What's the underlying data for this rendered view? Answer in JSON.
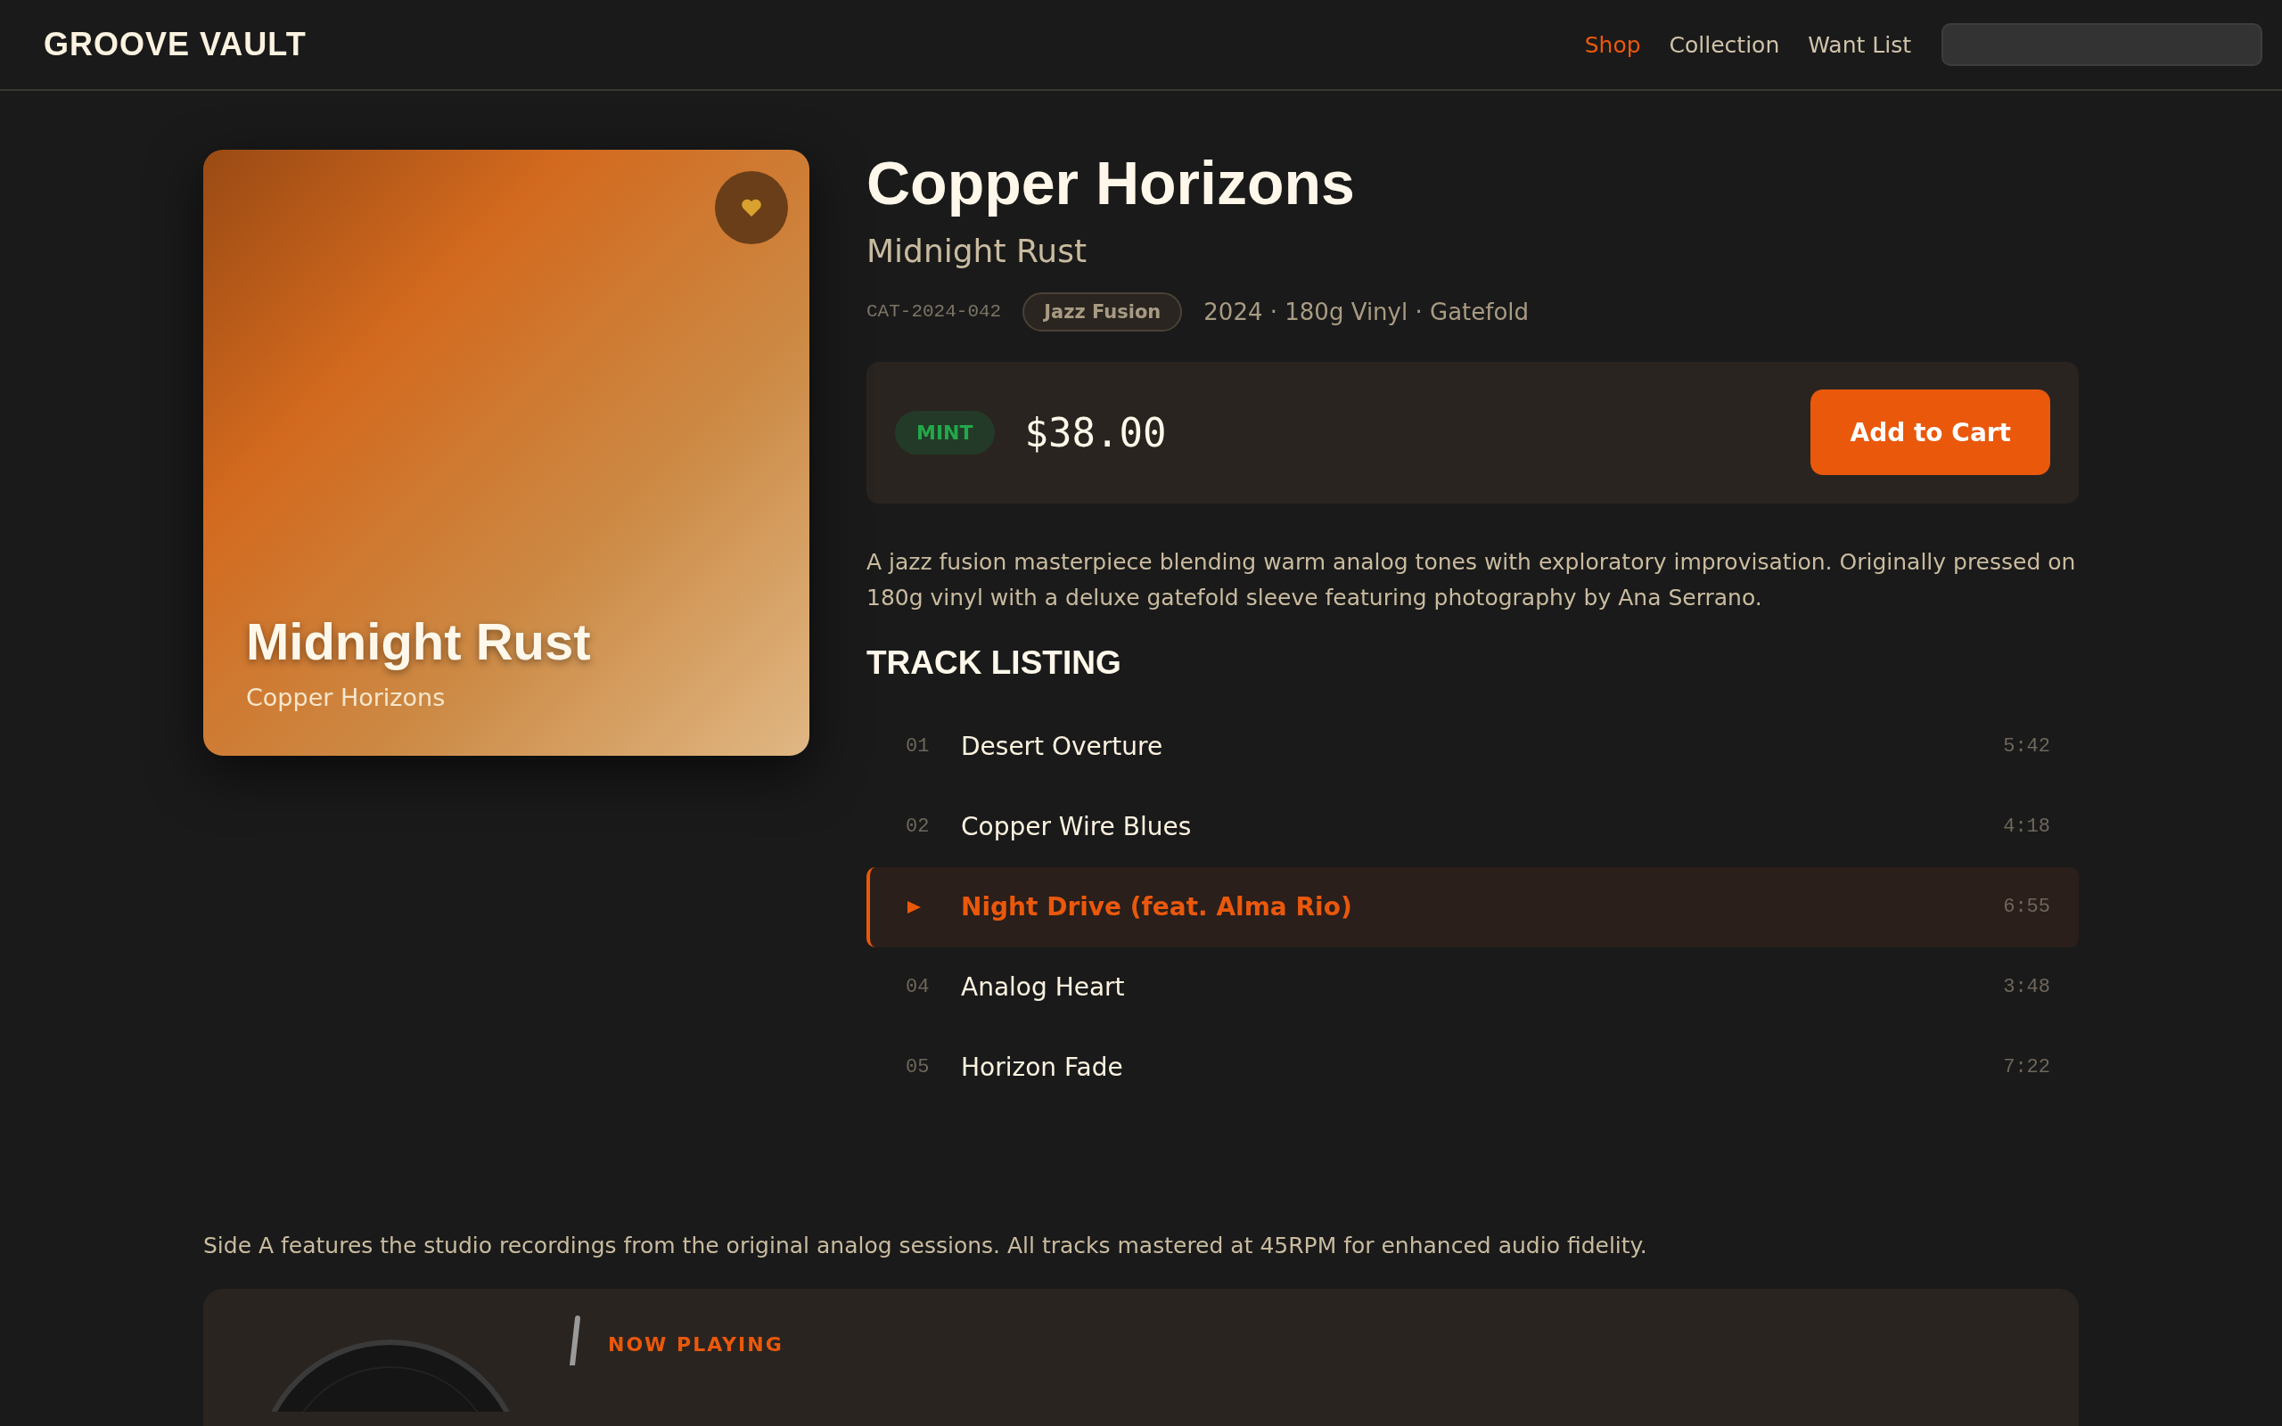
{
  "header": {
    "logo": "GROOVE VAULT",
    "nav": [
      {
        "label": "Shop",
        "selected": true
      },
      {
        "label": "Collection",
        "selected": false
      },
      {
        "label": "Want List",
        "selected": false
      }
    ]
  },
  "cover": {
    "title": "Midnight Rust",
    "artist": "Copper Horizons"
  },
  "album": {
    "title": "Copper Horizons",
    "artist": "Midnight Rust",
    "catalog": "CAT-2024-042",
    "genre": "Jazz Fusion",
    "details": "2024 · 180g Vinyl · Gatefold"
  },
  "purchase": {
    "condition": "MINT",
    "price": "$38.00",
    "button": "Add to Cart"
  },
  "description": "A jazz fusion masterpiece blending warm analog tones with exploratory improvisation. Originally pressed on 180g vinyl with a deluxe gatefold sleeve featuring photography by Ana Serrano.",
  "tracklist": {
    "heading": "TRACK LISTING",
    "tracks": [
      {
        "number": "01",
        "title": "Desert Overture",
        "duration": "5:42",
        "selected": false
      },
      {
        "number": "02",
        "title": "Copper Wire Blues",
        "duration": "4:18",
        "selected": false
      },
      {
        "title": "Night Drive (feat. Alma Rio)",
        "duration": "6:55",
        "selected": true
      },
      {
        "number": "04",
        "title": "Analog Heart",
        "duration": "3:48",
        "selected": false
      },
      {
        "number": "05",
        "title": "Horizon Fade",
        "duration": "7:22",
        "selected": false
      }
    ]
  },
  "side_note": "Side A features the studio recordings from the original analog sessions. All tracks mastered at 45RPM for enhanced audio fidelity.",
  "player": {
    "label": "NOW PLAYING"
  }
}
